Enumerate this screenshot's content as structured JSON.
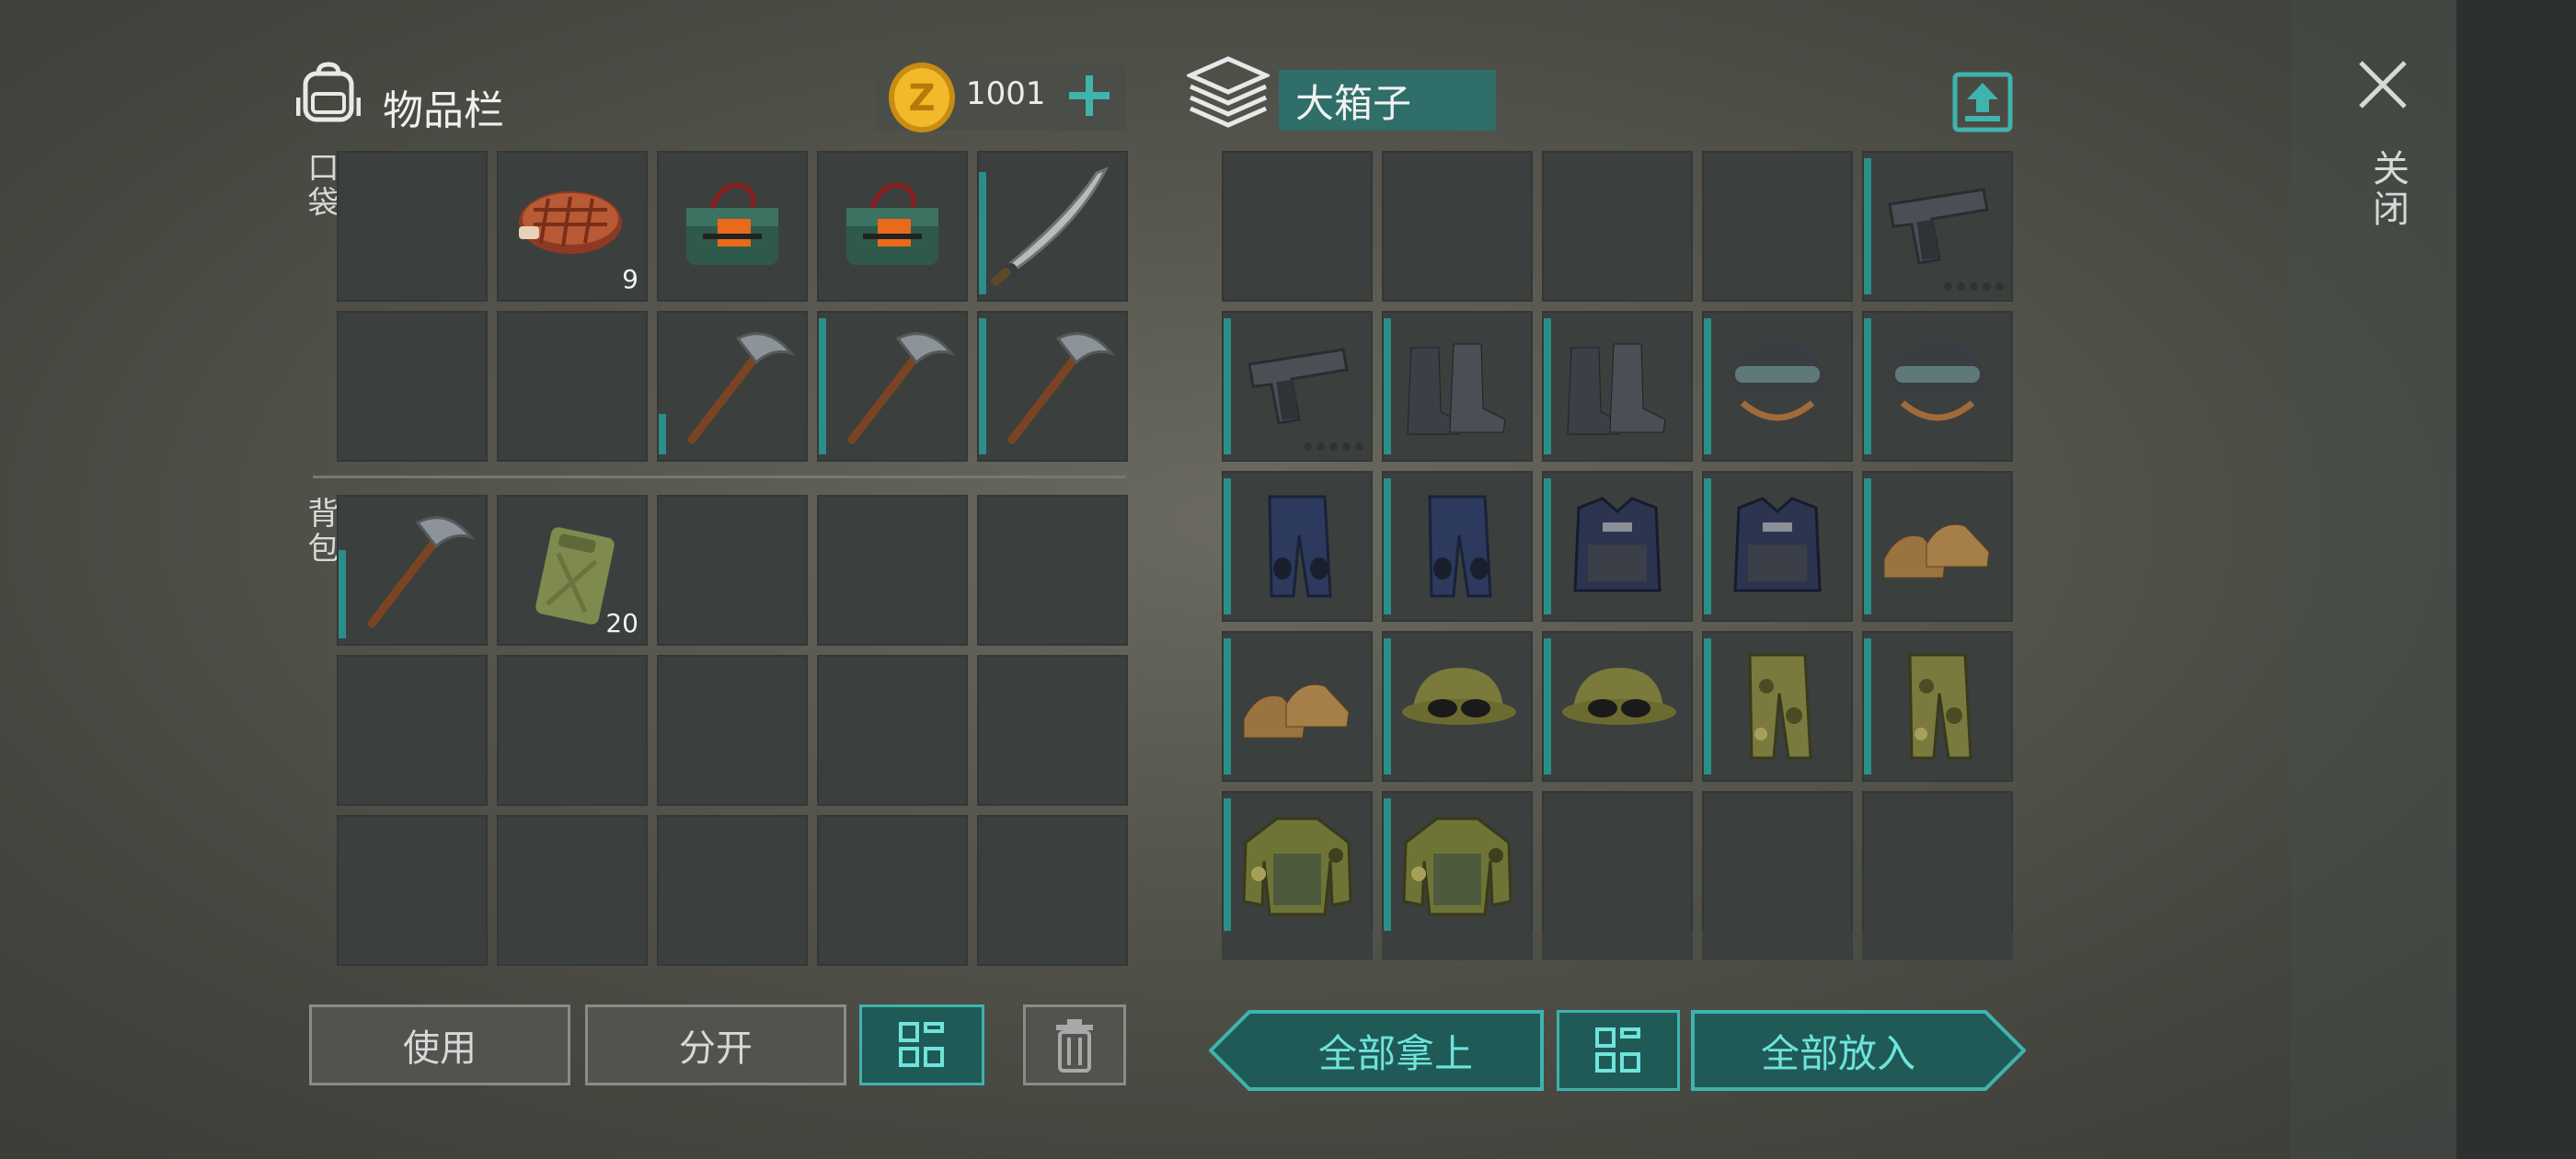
{
  "inventory": {
    "title": "物品栏",
    "pocket_label": "口袋",
    "backpack_label": "背包",
    "coins": "1001",
    "coin_letter": "Z",
    "pocket_slots": [
      {
        "item": "",
        "count": "",
        "durability": 0
      },
      {
        "item": "steak",
        "count": "9",
        "durability": 0
      },
      {
        "item": "explosive-charge",
        "count": "",
        "durability": 0
      },
      {
        "item": "explosive-charge",
        "count": "",
        "durability": 0
      },
      {
        "item": "machete",
        "count": "",
        "durability": 0.9
      },
      {
        "item": "",
        "count": "",
        "durability": 0
      },
      {
        "item": "",
        "count": "",
        "durability": 0
      },
      {
        "item": "pickaxe",
        "count": "",
        "durability": 0.3
      },
      {
        "item": "pickaxe",
        "count": "",
        "durability": 1
      },
      {
        "item": "pickaxe",
        "count": "",
        "durability": 1
      }
    ],
    "backpack_slots": [
      {
        "item": "pickaxe",
        "count": "",
        "durability": 0.65
      },
      {
        "item": "jerrycan",
        "count": "20",
        "durability": 0
      },
      {
        "item": "",
        "count": "",
        "durability": 0
      },
      {
        "item": "",
        "count": "",
        "durability": 0
      },
      {
        "item": "",
        "count": "",
        "durability": 0
      },
      {
        "item": "",
        "count": "",
        "durability": 0
      },
      {
        "item": "",
        "count": "",
        "durability": 0
      },
      {
        "item": "",
        "count": "",
        "durability": 0
      },
      {
        "item": "",
        "count": "",
        "durability": 0
      },
      {
        "item": "",
        "count": "",
        "durability": 0
      },
      {
        "item": "",
        "count": "",
        "durability": 0
      },
      {
        "item": "",
        "count": "",
        "durability": 0
      },
      {
        "item": "",
        "count": "",
        "durability": 0
      },
      {
        "item": "",
        "count": "",
        "durability": 0
      },
      {
        "item": "",
        "count": "",
        "durability": 0
      }
    ],
    "use_label": "使用",
    "split_label": "分开"
  },
  "container": {
    "name": "大箱子",
    "close_label": "关闭",
    "slots": [
      {
        "item": "",
        "durability": 0
      },
      {
        "item": "",
        "durability": 0
      },
      {
        "item": "",
        "durability": 0
      },
      {
        "item": "",
        "durability": 0
      },
      {
        "item": "pistol",
        "durability": 1,
        "pips": 5
      },
      {
        "item": "pistol",
        "durability": 1,
        "pips": 5
      },
      {
        "item": "boots",
        "durability": 1
      },
      {
        "item": "boots",
        "durability": 1
      },
      {
        "item": "helmet",
        "durability": 1
      },
      {
        "item": "helmet",
        "durability": 1
      },
      {
        "item": "police-pants",
        "durability": 1
      },
      {
        "item": "police-pants",
        "durability": 1
      },
      {
        "item": "police-vest",
        "durability": 1
      },
      {
        "item": "police-vest",
        "durability": 1
      },
      {
        "item": "shoes",
        "durability": 1
      },
      {
        "item": "shoes",
        "durability": 1
      },
      {
        "item": "camo-cap",
        "durability": 1
      },
      {
        "item": "camo-cap",
        "durability": 1
      },
      {
        "item": "camo-pants",
        "durability": 1
      },
      {
        "item": "camo-pants",
        "durability": 1
      },
      {
        "item": "camo-jacket",
        "durability": 1
      },
      {
        "item": "camo-jacket",
        "durability": 1
      },
      {
        "item": "",
        "durability": 0
      },
      {
        "item": "",
        "durability": 0
      },
      {
        "item": "",
        "durability": 0
      }
    ],
    "take_all_label": "全部拿上",
    "put_all_label": "全部放入"
  },
  "colors": {
    "accent": "#3fb3ad",
    "teal_dark": "#1f5a57",
    "slot": "#3b3f3e"
  }
}
